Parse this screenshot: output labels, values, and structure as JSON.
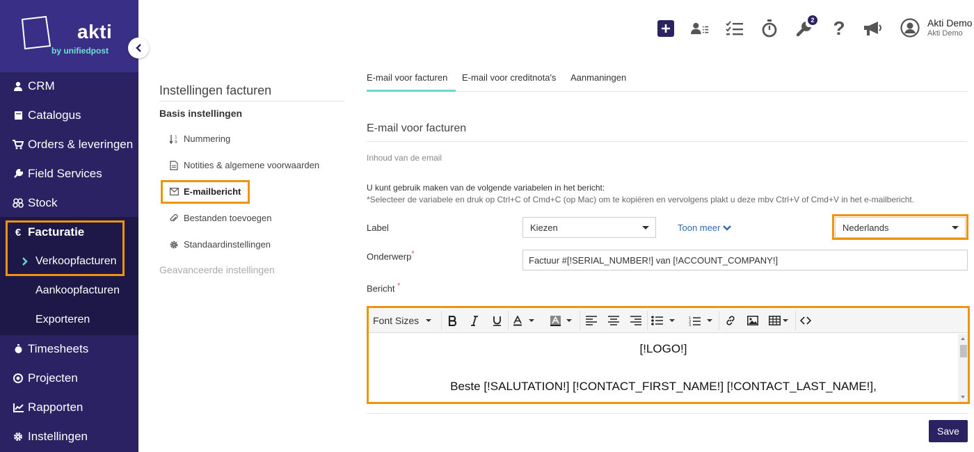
{
  "brand": {
    "name": "akti",
    "sub": "by unifiedpost"
  },
  "sidebar": {
    "items": [
      {
        "label": "CRM",
        "icon": "user-icon"
      },
      {
        "label": "Catalogus",
        "icon": "book-icon"
      },
      {
        "label": "Orders & leveringen",
        "icon": "cart-icon"
      },
      {
        "label": "Field Services",
        "icon": "wrench-icon"
      },
      {
        "label": "Stock",
        "icon": "boxes-icon"
      },
      {
        "label": "Facturatie",
        "icon": "euro-icon"
      },
      {
        "label": "Timesheets",
        "icon": "stopwatch-icon"
      },
      {
        "label": "Projecten",
        "icon": "target-icon"
      },
      {
        "label": "Rapporten",
        "icon": "chart-icon"
      },
      {
        "label": "Instellingen",
        "icon": "gear-icon"
      }
    ],
    "submenu": [
      "Verkoopfacturen",
      "Aankoopfacturen",
      "Exporteren"
    ]
  },
  "topbar": {
    "badge_count": "2",
    "user_name": "Akti Demo",
    "user_company": "Akti Demo"
  },
  "settings_nav": {
    "title": "Instellingen facturen",
    "basis": "Basis instellingen",
    "items": [
      "Nummering",
      "Notities & algemene voorwaarden",
      "E-mailbericht",
      "Bestanden toevoegen",
      "Standaardinstellingen"
    ],
    "advanced": "Geavanceerde instellingen"
  },
  "tabs": [
    "E-mail voor facturen",
    "E-mail voor creditnota's",
    "Aanmaningen"
  ],
  "main": {
    "section_title": "E-mail voor facturen",
    "content_label": "Inhoud van de email",
    "variables_info": "U kunt gebruik maken van de volgende variabelen in het bericht:",
    "variables_note": "*Selecteer de variabele en druk op Ctrl+C of Cmd+C (op Mac) om te kopiëren en vervolgens plakt u deze mbv Ctrl+V of Cmd+V in het e-mailbericht.",
    "label_label": "Label",
    "label_select": "Kiezen",
    "toon_meer": "Toon meer",
    "language_select": "Nederlands",
    "subject_label": "Onderwerp",
    "subject_value": "Factuur #[!SERIAL_NUMBER!] van [!ACCOUNT_COMPANY!]",
    "message_label": "Bericht",
    "required_mark": "*"
  },
  "editor": {
    "font_sizes": "Font Sizes",
    "line1": "[!LOGO!]",
    "line2": "Beste [!SALUTATION!] [!CONTACT_FIRST_NAME!] [!CONTACT_LAST_NAME!],"
  },
  "save_label": "Save",
  "colors": {
    "sidebar": "#2a2262",
    "highlight": "#f0930f",
    "tab_accent": "#6dd5ce"
  }
}
